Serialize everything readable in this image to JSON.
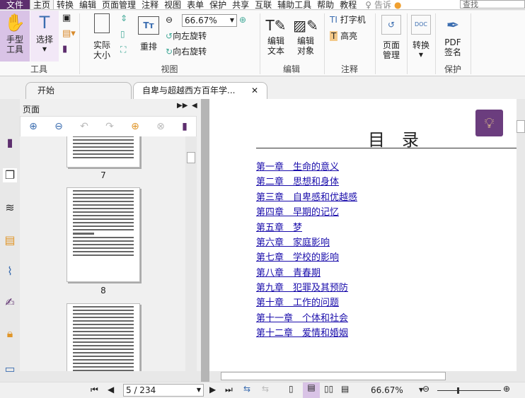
{
  "menu": {
    "file": "文件",
    "items": [
      "主页",
      "转换",
      "编辑",
      "页面管理",
      "注释",
      "视图",
      "表单",
      "保护",
      "共享",
      "互联",
      "辅助工具",
      "帮助",
      "教程"
    ],
    "tell": "告诉",
    "search_placeholder": "查找"
  },
  "ribbon": {
    "hand": "手型\n工具",
    "select": "选择",
    "tools_group": "工具",
    "actual_size": "实际\n大小",
    "reflow": "重排",
    "zoom_value": "66.67%",
    "rotate_left": "向左旋转",
    "rotate_right": "向右旋转",
    "view_group": "视图",
    "edit_text": "编辑\n文本",
    "edit_object": "编辑\n对象",
    "edit_group": "编辑",
    "typewriter": "打字机",
    "highlight": "高亮",
    "comment_group": "注释",
    "page_manage": "页面\n管理",
    "convert": "转换",
    "pdf_sign": "PDF\n签名",
    "protect_group": "保护"
  },
  "tabs": [
    {
      "label": "开始"
    },
    {
      "label": "自卑与超越西方百年学..."
    }
  ],
  "panel": {
    "title": "页面",
    "pages": [
      "7",
      "8"
    ]
  },
  "document": {
    "title": "目　录",
    "toc": [
      "第一章　生命的意义",
      "第二章　思想和身体",
      "第三章　自卑感和优越感",
      "第四章　早期的记忆",
      "第五章　梦",
      "第六章　家庭影响",
      "第七章　学校的影响",
      "第八章　青春期",
      "第九章　犯罪及其预防",
      "第十章　工作的问题",
      "第十一章　个体和社会",
      "第十二章　爱情和婚姻"
    ]
  },
  "status": {
    "page": "5 / 234",
    "zoom": "66.67%"
  },
  "colors": {
    "brand": "#5d2e6e",
    "link": "#1a0dab"
  }
}
